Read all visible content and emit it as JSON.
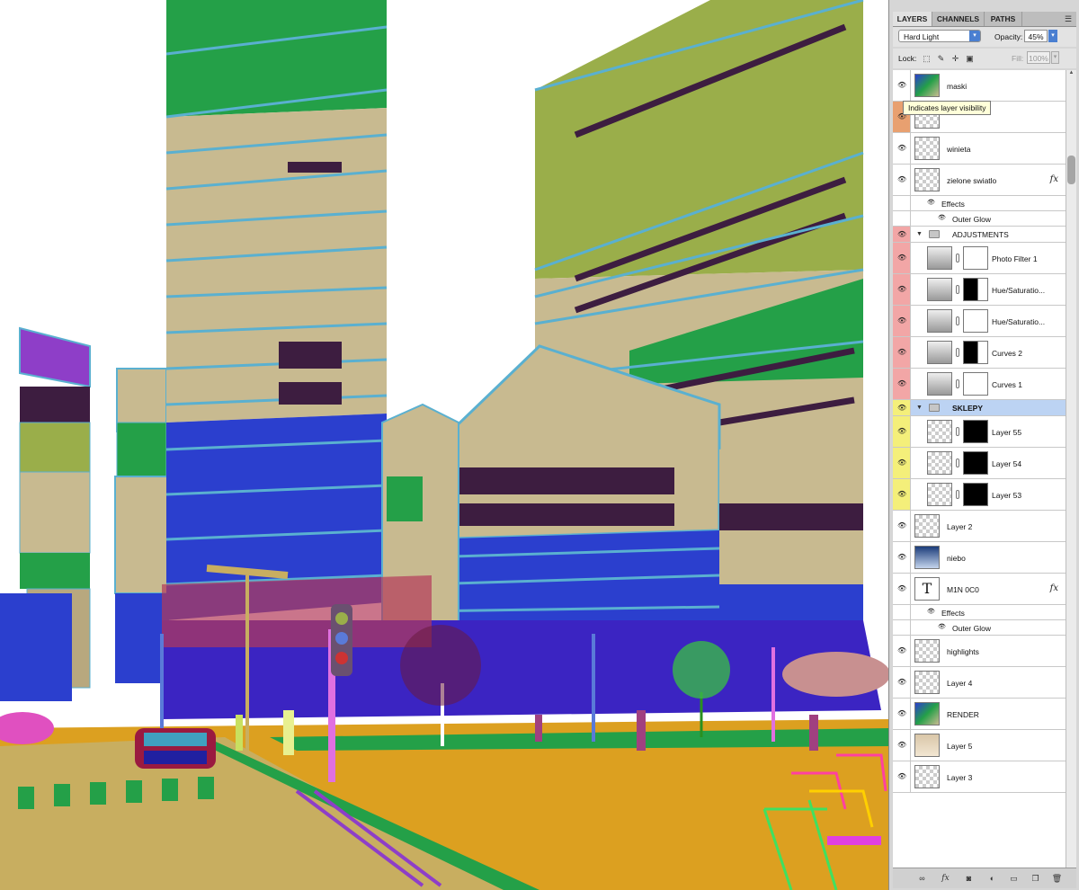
{
  "panel": {
    "tabs": [
      {
        "label": "LAYERS"
      },
      {
        "label": "CHANNELS"
      },
      {
        "label": "PATHS"
      }
    ],
    "menu_icon": "panel-menu-icon",
    "blend_mode": "Hard Light",
    "opacity_label": "Opacity:",
    "opacity_value": "45%",
    "lock_label": "Lock:",
    "fill_label": "Fill:",
    "fill_value": "100%",
    "tooltip": "Indicates layer visibility"
  },
  "layers": [
    {
      "name": "maski",
      "eye_color": "",
      "thumb": "image"
    },
    {
      "name": "",
      "eye_color": "#e8a070",
      "thumb": "checker"
    },
    {
      "name": "winieta",
      "eye_color": "",
      "thumb": "checker"
    },
    {
      "name": "zielone swiatlo",
      "eye_color": "",
      "thumb": "checker",
      "fx": "fx"
    },
    {
      "name": "Effects",
      "type": "effects"
    },
    {
      "name": "Outer Glow",
      "type": "effect"
    },
    {
      "name": "ADJUSTMENTS",
      "type": "group",
      "eye_color": "#f2a6a6"
    },
    {
      "name": "Photo Filter 1",
      "type": "adj",
      "eye_color": "#f2a6a6"
    },
    {
      "name": "Hue/Saturatio...",
      "type": "adj",
      "eye_color": "#f2a6a6"
    },
    {
      "name": "Hue/Saturatio...",
      "type": "adj",
      "eye_color": "#f2a6a6"
    },
    {
      "name": "Curves 2",
      "type": "adj",
      "eye_color": "#f2a6a6"
    },
    {
      "name": "Curves 1",
      "type": "adj",
      "eye_color": "#f2a6a6"
    },
    {
      "name": "SKLEPY",
      "type": "group",
      "eye_color": "#f4ef7a",
      "selected": true
    },
    {
      "name": "Layer 55",
      "type": "masked",
      "eye_color": "#f4ef7a"
    },
    {
      "name": "Layer 54",
      "type": "masked",
      "eye_color": "#f4ef7a"
    },
    {
      "name": "Layer 53",
      "type": "masked",
      "eye_color": "#f4ef7a"
    },
    {
      "name": "Layer 2",
      "eye_color": "",
      "thumb": "checker"
    },
    {
      "name": "niebo",
      "eye_color": "",
      "thumb": "sky"
    },
    {
      "name": "M1N 0C0",
      "eye_color": "",
      "thumb": "text",
      "fx": "fx"
    },
    {
      "name": "Effects",
      "type": "effects"
    },
    {
      "name": "Outer Glow",
      "type": "effect"
    },
    {
      "name": "highlights",
      "eye_color": "",
      "thumb": "checker"
    },
    {
      "name": "Layer 4",
      "eye_color": "",
      "thumb": "checker"
    },
    {
      "name": "RENDER",
      "eye_color": "",
      "thumb": "image"
    },
    {
      "name": "Layer 5",
      "eye_color": "",
      "thumb": "warm"
    },
    {
      "name": "Layer 3",
      "eye_color": "",
      "thumb": "checker"
    }
  ],
  "text_thumb_glyph": "T",
  "icons": {
    "lock": [
      "lock-transparent-icon",
      "lock-image-icon",
      "lock-position-icon",
      "lock-all-icon"
    ],
    "bottom": [
      "link-layers-icon",
      "add-style-icon",
      "add-mask-icon",
      "new-adjustment-icon",
      "new-group-icon",
      "new-layer-icon",
      "delete-layer-icon"
    ]
  }
}
